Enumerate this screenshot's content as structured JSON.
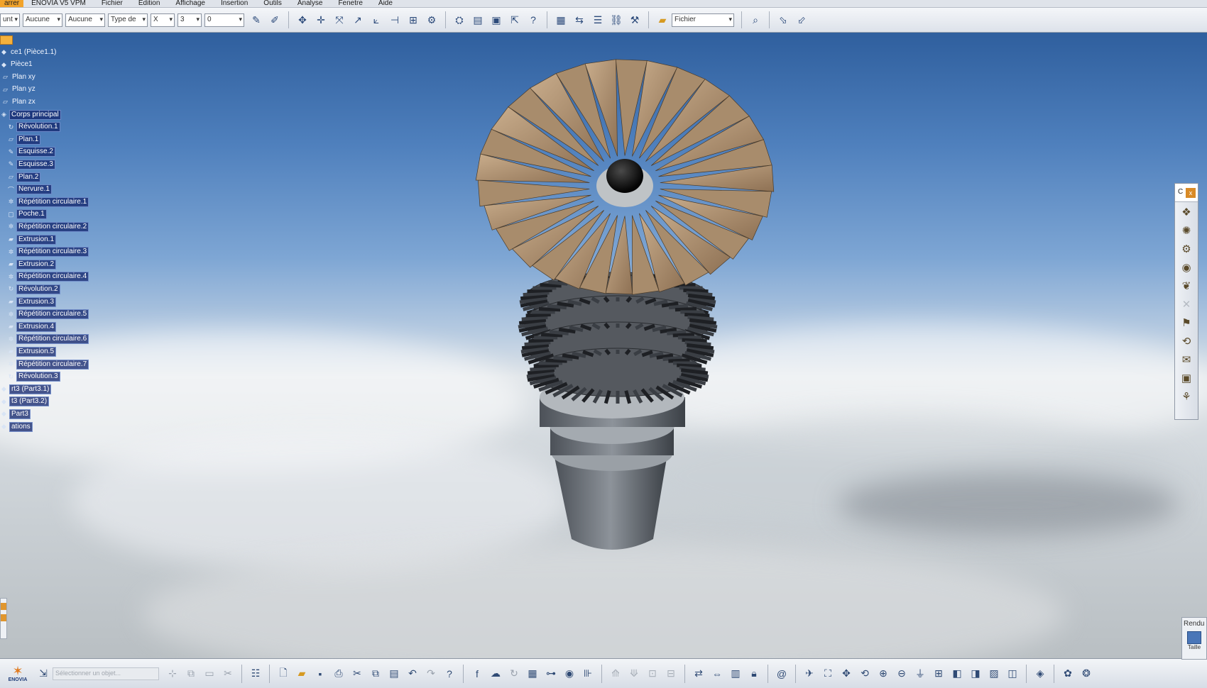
{
  "menubar": {
    "items": [
      "arrer",
      "ENOVIA V5 VPM",
      "Fichier",
      "Edition",
      "Affichage",
      "Insertion",
      "Outils",
      "Analyse",
      "Fenetre",
      "Aide"
    ]
  },
  "toolbar": {
    "selects": [
      {
        "value": "unt",
        "width": 28
      },
      {
        "value": "Aucune",
        "width": 56
      },
      {
        "value": "Aucune",
        "width": 56
      },
      {
        "value": "Type de",
        "width": 56
      },
      {
        "value": "X",
        "width": 34
      },
      {
        "value": "3",
        "width": 34
      },
      {
        "value": "0",
        "width": 56
      }
    ],
    "file_select": "Fichier"
  },
  "tree": {
    "items": [
      {
        "label": "ce1 (Pièce1.1)",
        "level": 0,
        "icon": "part-icon",
        "highlight": false
      },
      {
        "label": "Pièce1",
        "level": 0,
        "icon": "part-icon",
        "highlight": false
      },
      {
        "label": "Plan xy",
        "level": 1,
        "icon": "plane-icon",
        "highlight": false
      },
      {
        "label": "Plan yz",
        "level": 1,
        "icon": "plane-icon",
        "highlight": false
      },
      {
        "label": "Plan zx",
        "level": 1,
        "icon": "plane-icon",
        "highlight": false
      },
      {
        "label": "Corps principal",
        "level": 0,
        "icon": "body-icon",
        "highlight": true
      },
      {
        "label": "Révolution.1",
        "level": 2,
        "icon": "revolution-icon",
        "highlight": true
      },
      {
        "label": "Plan.1",
        "level": 2,
        "icon": "plane-icon",
        "highlight": true
      },
      {
        "label": "Esquisse.2",
        "level": 2,
        "icon": "sketch-icon",
        "highlight": true
      },
      {
        "label": "Esquisse.3",
        "level": 2,
        "icon": "sketch-icon",
        "highlight": true
      },
      {
        "label": "Plan.2",
        "level": 2,
        "icon": "plane-icon",
        "highlight": true
      },
      {
        "label": "Nervure.1",
        "level": 2,
        "icon": "rib-icon",
        "highlight": true
      },
      {
        "label": "Répétition circulaire.1",
        "level": 2,
        "icon": "pattern-icon",
        "highlight": true
      },
      {
        "label": "Poche.1",
        "level": 2,
        "icon": "pocket-icon",
        "highlight": true
      },
      {
        "label": "Répétition circulaire.2",
        "level": 2,
        "icon": "pattern-icon",
        "highlight": true
      },
      {
        "label": "Extrusion.1",
        "level": 2,
        "icon": "extrusion-icon",
        "highlight": true
      },
      {
        "label": "Répétition circulaire.3",
        "level": 2,
        "icon": "pattern-icon",
        "highlight": true
      },
      {
        "label": "Extrusion.2",
        "level": 2,
        "icon": "extrusion-icon",
        "highlight": true
      },
      {
        "label": "Répétition circulaire.4",
        "level": 2,
        "icon": "pattern-icon",
        "highlight": true
      },
      {
        "label": "Révolution.2",
        "level": 2,
        "icon": "revolution-icon",
        "highlight": true
      },
      {
        "label": "Extrusion.3",
        "level": 2,
        "icon": "extrusion-icon",
        "highlight": true
      },
      {
        "label": "Répétition circulaire.5",
        "level": 2,
        "icon": "pattern-icon",
        "highlight": true
      },
      {
        "label": "Extrusion.4",
        "level": 2,
        "icon": "extrusion-icon",
        "highlight": true
      },
      {
        "label": "Répétition circulaire.6",
        "level": 2,
        "icon": "pattern-icon",
        "highlight": true
      },
      {
        "label": "Extrusion.5",
        "level": 2,
        "icon": "extrusion-icon",
        "highlight": true
      },
      {
        "label": "Répétition circulaire.7",
        "level": 2,
        "icon": "pattern-icon",
        "highlight": true
      },
      {
        "label": "Révolution.3",
        "level": 2,
        "icon": "revolution-icon",
        "highlight": true
      },
      {
        "label": "rt3 (Part3.1)",
        "level": 0,
        "icon": "part-icon",
        "highlight": true
      },
      {
        "label": "t3 (Part3.2)",
        "level": 0,
        "icon": "part-icon",
        "highlight": true
      },
      {
        "label": "Part3",
        "level": 0,
        "icon": "part-icon",
        "highlight": true
      },
      {
        "label": "ations",
        "level": 0,
        "icon": "part-icon",
        "highlight": true
      }
    ]
  },
  "rightbar": {
    "header": "C",
    "close_label": "x",
    "icons": [
      "render-icon",
      "scene-icon",
      "light-icon",
      "camera-icon",
      "texture-icon",
      "disabled-icon",
      "material-icon",
      "turntable-icon",
      "shooting-icon",
      "image-icon",
      "settings-icon"
    ]
  },
  "bottombar": {
    "command_placeholder": "Sélectionner un objet...",
    "logo_text": "ENOVIA"
  },
  "rendu": {
    "title": "Rendu",
    "sub": "Taille"
  },
  "colors": {
    "tree_highlight": "#14286e",
    "menu_accent": "#f2a32a",
    "blade": "#b99c7c",
    "metal": "#8e9296"
  }
}
